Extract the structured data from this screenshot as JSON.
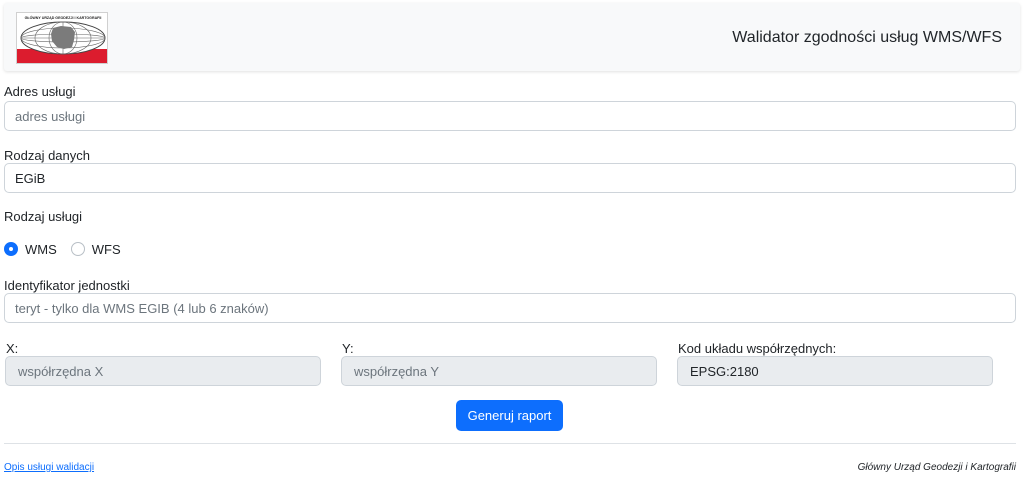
{
  "header": {
    "logo_text": "GŁÓWNY URZĄD GEODEZJI I KARTOGRAFII",
    "title": "Walidator zgodności usług WMS/WFS"
  },
  "form": {
    "address": {
      "label": "Adres usługi",
      "placeholder": "adres usługi",
      "value": ""
    },
    "data_type": {
      "label": "Rodzaj danych",
      "value": "EGiB"
    },
    "service_type": {
      "label": "Rodzaj usługi",
      "options": [
        {
          "label": "WMS",
          "checked": true
        },
        {
          "label": "WFS",
          "checked": false
        }
      ]
    },
    "unit_id": {
      "label": "Identyfikator jednostki",
      "placeholder": "teryt - tylko dla WMS EGIB (4 lub 6 znaków)",
      "value": ""
    },
    "x": {
      "label": "X:",
      "placeholder": "współrzędna X"
    },
    "y": {
      "label": "Y:",
      "placeholder": "współrzędna Y"
    },
    "crs": {
      "label": "Kod układu współrzędnych:",
      "value": "EPSG:2180"
    },
    "submit_label": "Generuj raport"
  },
  "footer": {
    "link": "Opis usługi walidacji",
    "org": "Główny Urząd Geodezji i Kartografii"
  },
  "colors": {
    "primary": "#0d6efd",
    "logo_red": "#dc1c2e",
    "navbar_bg": "#f8f9fa"
  }
}
